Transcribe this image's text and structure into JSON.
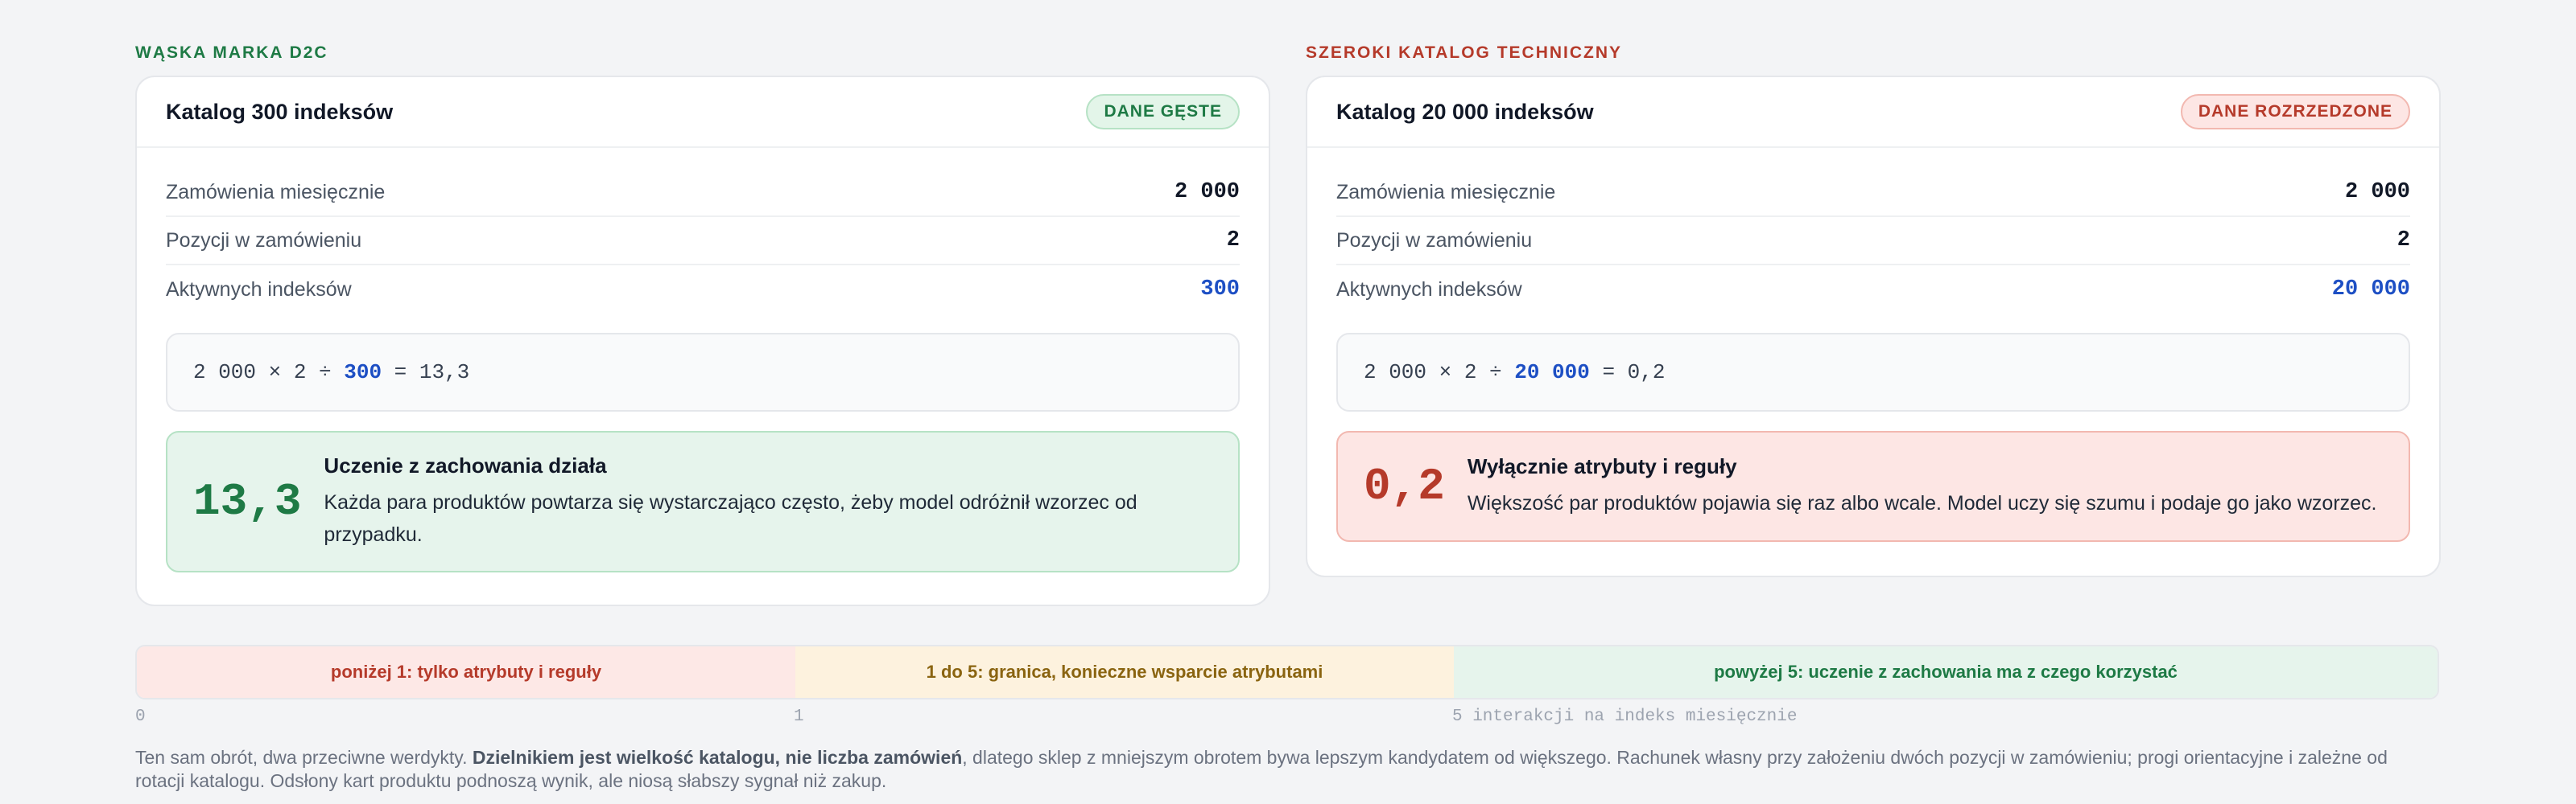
{
  "left": {
    "eyebrow": "WĄSKA MARKA D2C",
    "title": "Katalog 300 indeksów",
    "badge": "DANE GĘSTE",
    "rows": [
      {
        "label": "Zamówienia miesięcznie",
        "value": "2 000"
      },
      {
        "label": "Pozycji w zamówieniu",
        "value": "2"
      },
      {
        "label": "Aktywnych indeksów",
        "value": "300"
      }
    ],
    "formula": {
      "prefix": "2 000 × 2 ÷ ",
      "highlight": "300",
      "suffix": " = 13,3"
    },
    "verdict": {
      "number": "13,3",
      "title": "Uczenie z zachowania działa",
      "text": "Każda para produktów powtarza się wystarczająco często, żeby model odróżnił wzorzec od przypadku."
    }
  },
  "right": {
    "eyebrow": "SZEROKI KATALOG TECHNICZNY",
    "title": "Katalog 20 000 indeksów",
    "badge": "DANE ROZRZEDZONE",
    "rows": [
      {
        "label": "Zamówienia miesięcznie",
        "value": "2 000"
      },
      {
        "label": "Pozycji w zamówieniu",
        "value": "2"
      },
      {
        "label": "Aktywnych indeksów",
        "value": "20 000"
      }
    ],
    "formula": {
      "prefix": "2 000 × 2 ÷ ",
      "highlight": "20 000",
      "suffix": " = 0,2"
    },
    "verdict": {
      "number": "0,2",
      "title": "Wyłącznie atrybuty i reguły",
      "text": "Większość par produktów pojawia się raz albo wcale. Model uczy się szumu i podaje go jako wzorzec."
    }
  },
  "scale": {
    "segments": [
      "poniżej 1: tylko atrybuty i reguły",
      "1 do 5: granica, konieczne wsparcie atrybutami",
      "powyżej 5: uczenie z zachowania ma z czego korzystać"
    ],
    "ticks": [
      "0",
      "1",
      "5 interakcji na indeks miesięcznie"
    ]
  },
  "footnote": {
    "before": "Ten sam obrót, dwa przeciwne werdykty. ",
    "bold": "Dzielnikiem jest wielkość katalogu, nie liczba zamówień",
    "after": ", dlatego sklep z mniejszym obrotem bywa lepszym kandydatem od większego. Rachunek własny przy założeniu dwóch pozycji w zamówieniu; progi orientacyjne i zależne od rotacji katalogu. Odsłony kart produktu podnoszą wynik, ale niosą słabszy sygnał niż zakup."
  },
  "colors": {
    "green": "#1e7a45",
    "red": "#b53a2a",
    "blue": "#1d4fc4",
    "amber": "#8a6410"
  }
}
